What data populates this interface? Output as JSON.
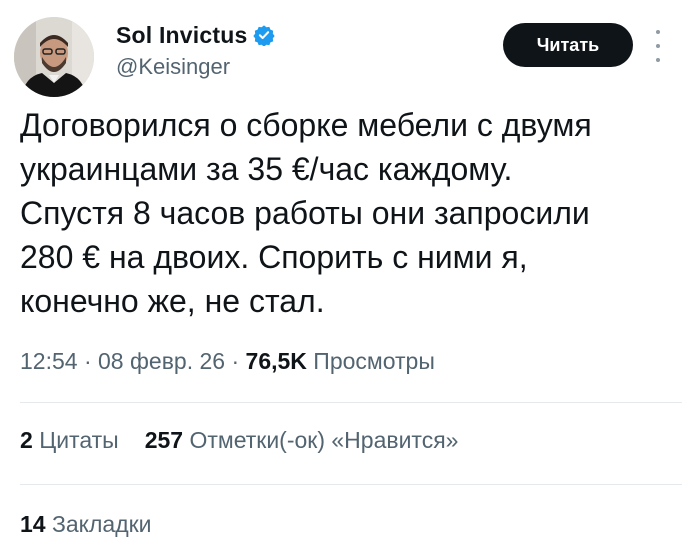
{
  "author": {
    "display_name": "Sol Invictus",
    "handle": "@Keisinger",
    "verified_color": "#1d9bf0"
  },
  "actions": {
    "follow_label": "Читать",
    "more_icon": "vertical-dots-icon"
  },
  "tweet": {
    "text_lines": [
      "Договорился о сборке мебели с двумя",
      "украинцами за 35 €/час каждому.",
      "Спустя 8 часов работы они запросили",
      "280 € на двоих. Спорить с ними я,",
      "конечно же, не стал."
    ]
  },
  "meta": {
    "time": "12:54",
    "separator": " · ",
    "date": "08 февр. 26",
    "views_count": "76,5K",
    "views_label": "Просмотры"
  },
  "stats": {
    "quotes_count": "2",
    "quotes_label": "Цитаты",
    "likes_count": "257",
    "likes_label": "Отметки(-ок) «Нравится»",
    "bookmarks_count": "14",
    "bookmarks_label": "Закладки"
  }
}
